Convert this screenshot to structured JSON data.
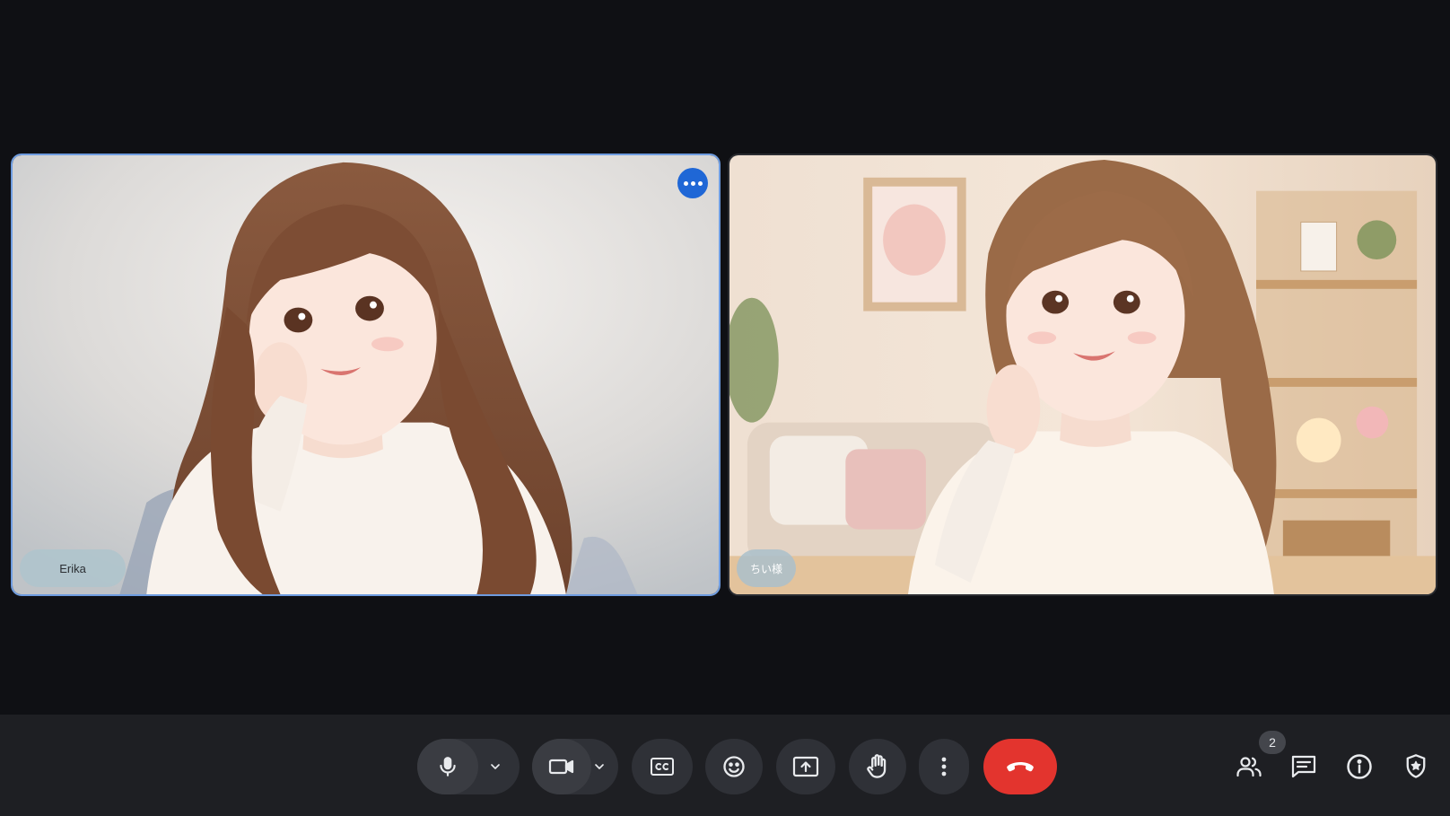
{
  "participants": [
    {
      "name": "Erika",
      "active_speaker": true
    },
    {
      "name": "ちい様",
      "active_speaker": false
    }
  ],
  "toolbar": {
    "buttons": [
      {
        "icon": "microphone-icon",
        "has_options": true
      },
      {
        "icon": "camera-icon",
        "has_options": true
      },
      {
        "icon": "closed-captions-icon"
      },
      {
        "icon": "emoji-icon"
      },
      {
        "icon": "present-screen-icon"
      },
      {
        "icon": "raise-hand-icon"
      },
      {
        "icon": "more-vert-icon"
      },
      {
        "icon": "end-call-icon"
      }
    ],
    "right": {
      "people_count": "2",
      "icons": [
        "people-icon",
        "chat-icon",
        "info-icon",
        "host-controls-icon"
      ]
    }
  },
  "colors": {
    "active_border": "#6e9ce0",
    "end_call": "#e3342e",
    "more_button": "#1f67d6"
  }
}
